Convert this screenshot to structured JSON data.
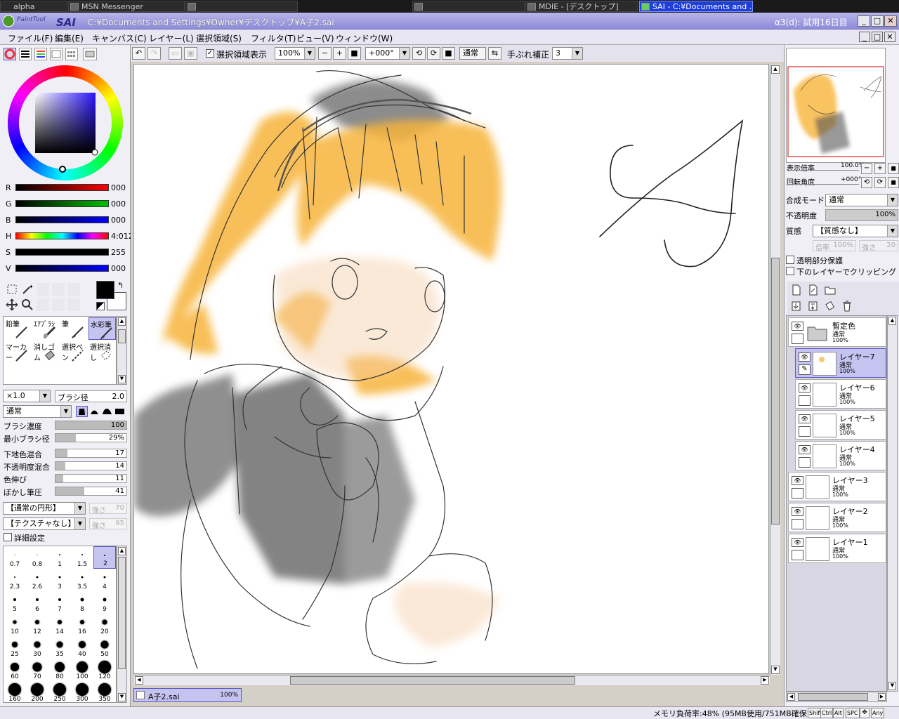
{
  "taskbar": {
    "items": [
      {
        "label": "alpha"
      },
      {
        "label": "MSN Messenger"
      },
      {
        "label": ""
      },
      {
        "label": ""
      },
      {
        "label": "MDIE - [デスクトップ]"
      },
      {
        "label": "SAI - C:¥Documents and ..."
      }
    ]
  },
  "title": {
    "app_logo": "PaintTool SAI",
    "path": "C:¥Documents and Settings¥Owner¥デスクトップ¥A子2.sai",
    "trial": "α3(d): 試用16日目"
  },
  "menu": [
    "ファイル(F)",
    "編集(E)",
    "キャンバス(C)",
    "レイヤー(L)",
    "選択領域(S)",
    "フィルタ(T)",
    "ビュー(V)",
    "ウィンドウ(W)"
  ],
  "toolbar": {
    "show_selection_label": "選択領域表示",
    "zoom": "100%",
    "rotation": "+000°",
    "blend": "通常",
    "stabilizer_label": "手ぶれ補正",
    "stabilizer_value": "3"
  },
  "color": {
    "sliders": [
      {
        "label": "R",
        "value": "000",
        "fill": "#ff0000"
      },
      {
        "label": "G",
        "value": "000",
        "fill": "#00c000"
      },
      {
        "label": "B",
        "value": "000",
        "fill": "#0000ff"
      },
      {
        "label": "H",
        "value": "4:012",
        "fill": "rainbow"
      },
      {
        "label": "S",
        "value": "255",
        "fill": "#000000"
      },
      {
        "label": "V",
        "value": "000",
        "fill": "#0000ff"
      }
    ],
    "primary": "#000000",
    "secondary": "#ffffff"
  },
  "tools": [
    {
      "label": "鉛筆"
    },
    {
      "label": "ｴｱﾌﾞﾗｼ"
    },
    {
      "label": "筆"
    },
    {
      "label": "水彩筆"
    },
    {
      "label": "マーカー"
    },
    {
      "label": "消しゴム"
    },
    {
      "label": "選択ペン"
    },
    {
      "label": "選択消し"
    }
  ],
  "brush": {
    "size_mult": "×1.0",
    "size_label": "ブラシ径",
    "size_value": "2.0",
    "mode": "通常",
    "params": [
      {
        "label": "ブラシ濃度",
        "value": "100",
        "pct": 1.0
      },
      {
        "label": "最小ブラシ径",
        "value": "29%",
        "pct": 0.29
      },
      {
        "label": "下地色混合",
        "value": "17",
        "pct": 0.17
      },
      {
        "label": "不透明度混合",
        "value": "14",
        "pct": 0.14
      },
      {
        "label": "色伸び",
        "value": "11",
        "pct": 0.11
      },
      {
        "label": "ぼかし筆圧",
        "value": "41",
        "pct": 0.41
      }
    ],
    "shape": "【通常の円形】",
    "shape_strength": "強さ",
    "shape_strength_val": "70",
    "texture": "【テクスチャなし】",
    "texture_strength": "強さ",
    "texture_strength_val": "95",
    "advanced": "詳細設定",
    "sizes": [
      "0.7",
      "0.8",
      "1",
      "1.5",
      "2",
      "2.3",
      "2.6",
      "3",
      "3.5",
      "4",
      "5",
      "6",
      "7",
      "8",
      "9",
      "10",
      "12",
      "14",
      "16",
      "20",
      "25",
      "30",
      "35",
      "40",
      "50",
      "60",
      "70",
      "80",
      "100",
      "120",
      "160",
      "200",
      "250",
      "300",
      "350"
    ]
  },
  "navigator": {
    "zoom_label": "表示倍率",
    "zoom_value": "100.0%",
    "rot_label": "回転角度",
    "rot_value": "+000°"
  },
  "layer_props": {
    "blend_label": "合成モード",
    "blend_value": "通常",
    "opacity_label": "不透明度",
    "opacity_value": "100%",
    "texture_label": "質感",
    "texture_value": "【質感なし】",
    "scale_label": "倍率",
    "scale_value": "100%",
    "strength_label": "強さ",
    "strength_value": "20",
    "protect_label": "透明部分保護",
    "clip_label": "下のレイヤーでクリッピング"
  },
  "layers": [
    {
      "name": "暫定色",
      "mode": "通常",
      "opacity": "100%",
      "folder": true
    },
    {
      "name": "レイヤー7",
      "mode": "通常",
      "opacity": "100%"
    },
    {
      "name": "レイヤー6",
      "mode": "通常",
      "opacity": "100%"
    },
    {
      "name": "レイヤー5",
      "mode": "通常",
      "opacity": "100%"
    },
    {
      "name": "レイヤー4",
      "mode": "通常",
      "opacity": "100%"
    },
    {
      "name": "レイヤー3",
      "mode": "通常",
      "opacity": "100%"
    },
    {
      "name": "レイヤー2",
      "mode": "通常",
      "opacity": "100%"
    },
    {
      "name": "レイヤー1",
      "mode": "通常",
      "opacity": "100%"
    }
  ],
  "doc_tab": {
    "name": "A子2.sai",
    "zoom": "100%"
  },
  "status": {
    "memory": "メモリ負荷率:48% (95MB使用/751MB確保)",
    "keys": [
      "Shift",
      "Ctrl",
      "Alt",
      "SPC",
      "Any"
    ]
  }
}
